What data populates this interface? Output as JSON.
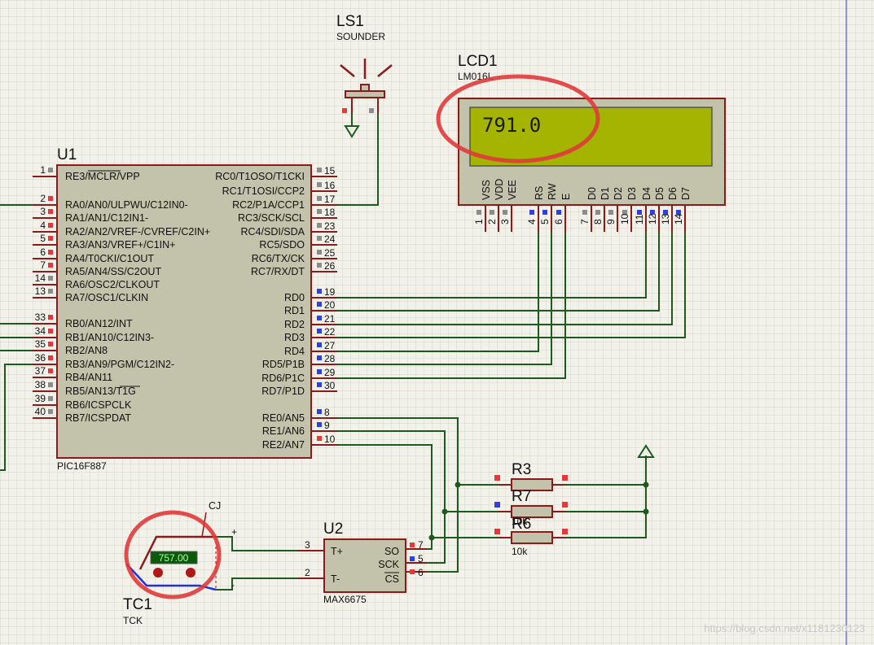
{
  "components": {
    "ls1": {
      "ref": "LS1",
      "value": "SOUNDER"
    },
    "lcd1": {
      "ref": "LCD1",
      "value": "LM016L",
      "display": "791.0",
      "pin_labels": [
        "VSS",
        "VDD",
        "VEE",
        "RS",
        "RW",
        "E",
        "D0",
        "D1",
        "D2",
        "D3",
        "D4",
        "D5",
        "D6",
        "D7"
      ],
      "pin_numbers": [
        "1",
        "2",
        "3",
        "4",
        "5",
        "6",
        "7",
        "8",
        "9",
        "10",
        "11",
        "12",
        "13",
        "14"
      ]
    },
    "u1": {
      "ref": "U1",
      "value": "PIC16F887",
      "left_pins": [
        {
          "num": "1",
          "label": "RE3/MCLR/VPP"
        },
        {
          "num": "2",
          "label": "RA0/AN0/ULPWU/C12IN0-"
        },
        {
          "num": "3",
          "label": "RA1/AN1/C12IN1-"
        },
        {
          "num": "4",
          "label": "RA2/AN2/VREF-/CVREF/C2IN+"
        },
        {
          "num": "5",
          "label": "RA3/AN3/VREF+/C1IN+"
        },
        {
          "num": "6",
          "label": "RA4/T0CKI/C1OUT"
        },
        {
          "num": "7",
          "label": "RA5/AN4/SS/C2OUT"
        },
        {
          "num": "14",
          "label": "RA6/OSC2/CLKOUT"
        },
        {
          "num": "13",
          "label": "RA7/OSC1/CLKIN"
        },
        {
          "num": "33",
          "label": "RB0/AN12/INT"
        },
        {
          "num": "34",
          "label": "RB1/AN10/C12IN3-"
        },
        {
          "num": "35",
          "label": "RB2/AN8"
        },
        {
          "num": "36",
          "label": "RB3/AN9/PGM/C12IN2-"
        },
        {
          "num": "37",
          "label": "RB4/AN11"
        },
        {
          "num": "38",
          "label": "RB5/AN13/T1G"
        },
        {
          "num": "39",
          "label": "RB6/ICSPCLK"
        },
        {
          "num": "40",
          "label": "RB7/ICSPDAT"
        }
      ],
      "right_pins": [
        {
          "num": "15",
          "label": "RC0/T1OSO/T1CKI"
        },
        {
          "num": "16",
          "label": "RC1/T1OSI/CCP2"
        },
        {
          "num": "17",
          "label": "RC2/P1A/CCP1"
        },
        {
          "num": "18",
          "label": "RC3/SCK/SCL"
        },
        {
          "num": "23",
          "label": "RC4/SDI/SDA"
        },
        {
          "num": "24",
          "label": "RC5/SDO"
        },
        {
          "num": "25",
          "label": "RC6/TX/CK"
        },
        {
          "num": "26",
          "label": "RC7/RX/DT"
        },
        {
          "num": "19",
          "label": "RD0"
        },
        {
          "num": "20",
          "label": "RD1"
        },
        {
          "num": "21",
          "label": "RD2"
        },
        {
          "num": "22",
          "label": "RD3"
        },
        {
          "num": "27",
          "label": "RD4"
        },
        {
          "num": "28",
          "label": "RD5/P1B"
        },
        {
          "num": "29",
          "label": "RD6/P1C"
        },
        {
          "num": "30",
          "label": "RD7/P1D"
        },
        {
          "num": "8",
          "label": "RE0/AN5"
        },
        {
          "num": "9",
          "label": "RE1/AN6"
        },
        {
          "num": "10",
          "label": "RE2/AN7"
        }
      ]
    },
    "u2": {
      "ref": "U2",
      "value": "MAX6675",
      "left_pins": [
        {
          "num": "3",
          "label": "T+"
        },
        {
          "num": "2",
          "label": "T-"
        }
      ],
      "right_pins": [
        {
          "num": "7",
          "label": "SO"
        },
        {
          "num": "5",
          "label": "SCK"
        },
        {
          "num": "6",
          "label": "CS"
        }
      ]
    },
    "tc1": {
      "ref": "TC1",
      "value": "TCK",
      "reading": "757.00",
      "cj_label": "CJ",
      "plus": "+",
      "minus": "-"
    },
    "r3": {
      "ref": "R3"
    },
    "r7": {
      "ref": "R7",
      "value": "10k"
    },
    "r6": {
      "ref": "R6",
      "value": "10k"
    }
  },
  "watermark": "https://blog.csdn.net/x1181230123",
  "colors": {
    "wire": "#1e5a1e",
    "body": "#c3c2aa",
    "outline": "#8b1a1a",
    "lcd": "#a4b400",
    "highlight": "#e03a3a"
  }
}
